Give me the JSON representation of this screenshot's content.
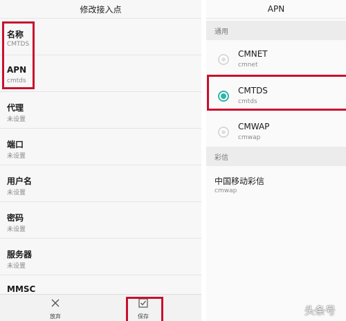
{
  "left": {
    "title": "修改接入点",
    "fields": [
      {
        "name": "名称",
        "value": "CMTDS"
      },
      {
        "name": "APN",
        "value": "cmtds"
      },
      {
        "name": "代理",
        "value": "未设置"
      },
      {
        "name": "端口",
        "value": "未设置"
      },
      {
        "name": "用户名",
        "value": "未设置"
      },
      {
        "name": "密码",
        "value": "未设置"
      },
      {
        "name": "服务器",
        "value": "未设置"
      },
      {
        "name": "MMSC",
        "value": ""
      }
    ],
    "bottom_bar": {
      "discard_label": "放弃",
      "save_label": "保存",
      "discard_icon": "close-icon",
      "save_icon": "checkbox-icon"
    }
  },
  "right": {
    "title": "APN",
    "section_general": "通用",
    "apns": [
      {
        "name": "CMNET",
        "value": "cmnet",
        "selected": false
      },
      {
        "name": "CMTDS",
        "value": "cmtds",
        "selected": true
      },
      {
        "name": "CMWAP",
        "value": "cmwap",
        "selected": false
      }
    ],
    "section_mms": "彩信",
    "mms": {
      "name": "中国移动彩信",
      "value": "cmwap"
    }
  },
  "watermark": "头条号",
  "colors": {
    "highlight_box": "#c8102e",
    "radio_selected": "#2bb5a6"
  }
}
